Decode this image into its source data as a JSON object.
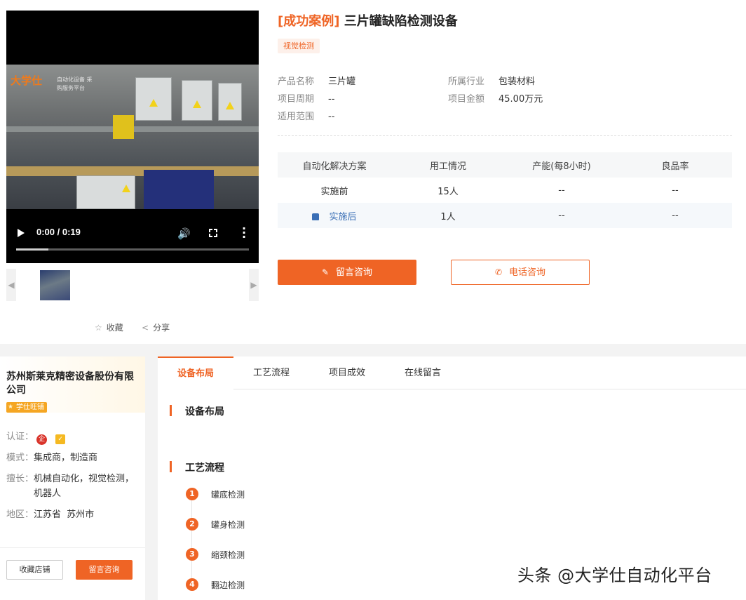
{
  "video": {
    "time": "0:00 / 0:19",
    "progress": 0.14,
    "logo_text": "大学仕",
    "logo_sub": "自动化设备 采购服务平台"
  },
  "thumb_nav": {
    "prev": "◀",
    "next": "▶"
  },
  "actions": {
    "favorite": "收藏",
    "share": "分享"
  },
  "product": {
    "tag": "[成功案例]",
    "title": "三片罐缺陷检测设备",
    "badge": "视觉检测",
    "meta": {
      "name_k": "产品名称",
      "name_v": "三片罐",
      "industry_k": "所属行业",
      "industry_v": "包装材料",
      "period_k": "项目周期",
      "period_v": "--",
      "amount_k": "项目金额",
      "amount_v": "45.00万元",
      "scope_k": "适用范围",
      "scope_v": "--"
    }
  },
  "table": {
    "headers": [
      "自动化解决方案",
      "用工情况",
      "产能(每8小时)",
      "良品率"
    ],
    "rows": [
      [
        "实施前",
        "15人",
        "--",
        "--"
      ],
      [
        "实施后",
        "1人",
        "--",
        "--"
      ]
    ]
  },
  "buttons": {
    "message": "留言咨询",
    "phone": "电话咨询"
  },
  "company": {
    "name": "苏州斯莱克精密设备股份有限公司",
    "shop_badge": "学仕旺铺",
    "cert_k": "认证：",
    "mode_k": "模式：",
    "mode_v": "集成商，制造商",
    "expertise_k": "擅长：",
    "expertise_v": "机械自动化，视觉检测，机器人",
    "region_k": "地区：",
    "region_v": "江苏省  苏州市",
    "follow_button": "收藏店铺",
    "message_button": "留言咨询"
  },
  "tabs": [
    "设备布局",
    "工艺流程",
    "项目成效",
    "在线留言"
  ],
  "sections": {
    "layout_title": "设备布局",
    "process_title": "工艺流程",
    "steps": [
      "罐底检测",
      "罐身检测",
      "缩颈检测",
      "翻边检测"
    ]
  },
  "watermark": "头条 @大学仕自动化平台",
  "colors": {
    "accent": "#ef6425",
    "link": "#3a6fb6"
  }
}
